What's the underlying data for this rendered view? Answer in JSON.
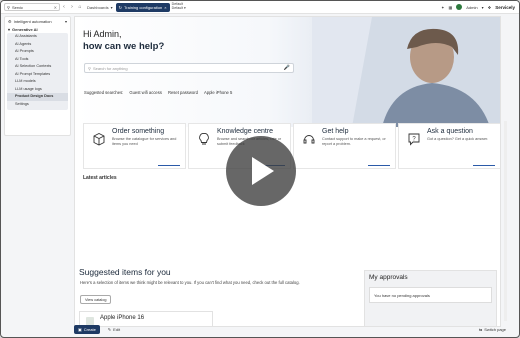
{
  "topbar": {
    "search_value": "Servic",
    "tab_dashboards": "Dashboards",
    "tab_active": "Training configuration",
    "default_small": "Default",
    "default_caret": "Default",
    "user": "Admin",
    "brand": "Servicely"
  },
  "sidebar": {
    "header": "Intelligent automation",
    "section": "Generative AI",
    "items": [
      {
        "label": "AI Assistants",
        "hl": false
      },
      {
        "label": "AI Agents",
        "hl": false
      },
      {
        "label": "AI Prompts",
        "hl": false
      },
      {
        "label": "AI Tools",
        "hl": false
      },
      {
        "label": "AI Selection Contexts",
        "hl": false
      },
      {
        "label": "AI Prompt Templates",
        "hl": false
      },
      {
        "label": "LLM models",
        "hl": false
      },
      {
        "label": "LLM usage logs",
        "hl": false
      },
      {
        "label": "Product Design Docs",
        "hl": true
      },
      {
        "label": "Settings",
        "hl": false
      }
    ]
  },
  "hero": {
    "greeting": "Hi Admin,",
    "question": "how can we help?",
    "search_placeholder": "Search for anything",
    "suggested_label": "Suggested searches:",
    "suggested": [
      "Guest wifi access",
      "Reset password",
      "Apple iPhone 5"
    ]
  },
  "cards": [
    {
      "title": "Order something",
      "desc": "Browse the catalogue for services and items you need",
      "icon": "box-icon"
    },
    {
      "title": "Knowledge centre",
      "desc": "Browse and search for articles, rate or submit feedback",
      "icon": "lightbulb-icon"
    },
    {
      "title": "Get help",
      "desc": "Contact support to make a request, or report a problem.",
      "icon": "headset-icon"
    },
    {
      "title": "Ask a question",
      "desc": "Got a question? Get a quick answer.",
      "icon": "question-icon"
    }
  ],
  "latest_articles": "Latest articles",
  "suggested_items": {
    "title": "Suggested items for you",
    "desc": "Here's a selection of items we think might be relevant to you. If you can't find what you need, check out the full catalog.",
    "button": "View catalog",
    "item": "Apple iPhone 16"
  },
  "approvals": {
    "title": "My approvals",
    "empty": "You have no pending approvals"
  },
  "bottombar": {
    "create": "Create",
    "edit": "Edit",
    "switch": "Switch page"
  },
  "colors": {
    "accent": "#1e3a64",
    "highlight": "#d9dde4"
  }
}
